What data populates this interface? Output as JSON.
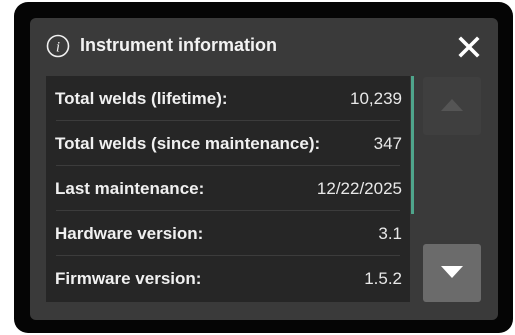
{
  "dialog": {
    "title": "Instrument information",
    "icons": {
      "info": "info-circle-icon",
      "close": "close-icon",
      "scroll_up": "triangle-up-icon",
      "scroll_down": "triangle-down-icon"
    },
    "accent_color": "#4fa58c"
  },
  "info_rows": [
    {
      "label": "Total welds (lifetime):",
      "value": "10,239"
    },
    {
      "label": "Total welds (since maintenance):",
      "value": "347"
    },
    {
      "label": "Last maintenance:",
      "value": "12/22/2025"
    },
    {
      "label": "Hardware version:",
      "value": "3.1"
    },
    {
      "label": "Firmware version:",
      "value": "1.5.2"
    }
  ]
}
